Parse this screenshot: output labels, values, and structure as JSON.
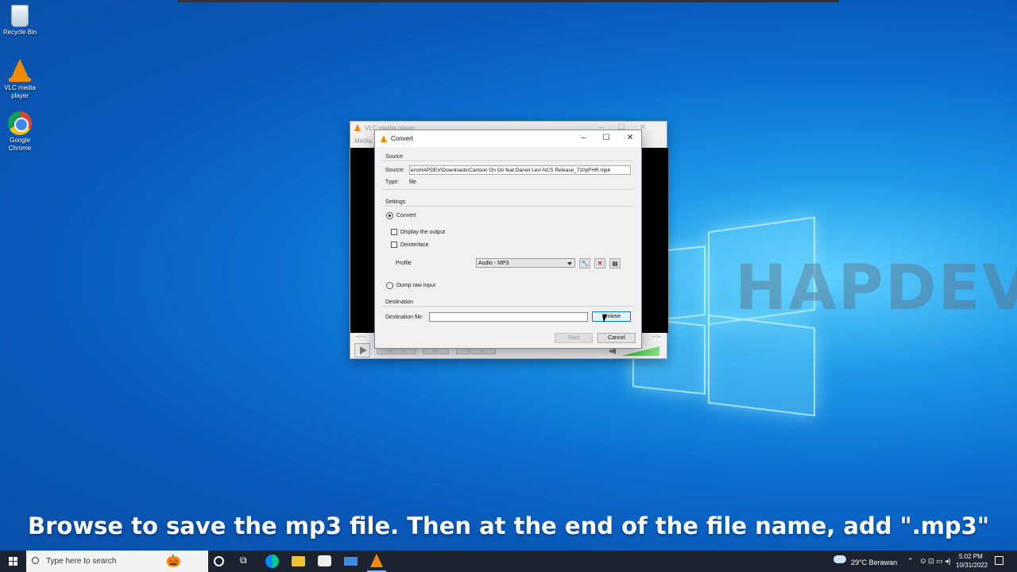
{
  "desktop": {
    "icons": [
      {
        "label": "Recycle Bin",
        "icon": "recycle-bin-icon"
      },
      {
        "label": "VLC media player",
        "icon": "vlc-icon"
      },
      {
        "label": "Google Chrome",
        "icon": "chrome-icon"
      }
    ],
    "watermark": "HAPDEV",
    "caption": "Browse to save the mp3 file. Then at the end of the file name, add \".mp3\""
  },
  "vlc_window": {
    "title": "VLC media player",
    "menu": "Media",
    "time_left": "--:--",
    "time_right": "--:--"
  },
  "convert_dialog": {
    "title": "Convert",
    "source_group": "Source",
    "source_label": "Source:",
    "source_value": "ers\\HAPDEV\\Downloads\\Cartoon  On  On feat Daniel Levi NCS Release_720pFHR.mp4",
    "type_label": "Type:",
    "type_value": "file",
    "settings_group": "Settings",
    "convert_label": "Convert",
    "display_output_label": "Display the output",
    "deinterlace_label": "Deinterlace",
    "profile_label": "Profile",
    "profile_value": "Audio - MP3",
    "dump_raw_label": "Dump raw input",
    "destination_group": "Destination",
    "destination_label": "Destination file:",
    "destination_value": "",
    "browse_label": "Browse",
    "start_label": "Start",
    "cancel_label": "Cancel",
    "convert_selected": true,
    "display_output_checked": false,
    "deinterlace_checked": false
  },
  "taskbar": {
    "search_placeholder": "Type here to search",
    "weather": "29°C  Berawan",
    "time": "5:02 PM",
    "date": "10/31/2022",
    "accent": "#f08a00"
  }
}
